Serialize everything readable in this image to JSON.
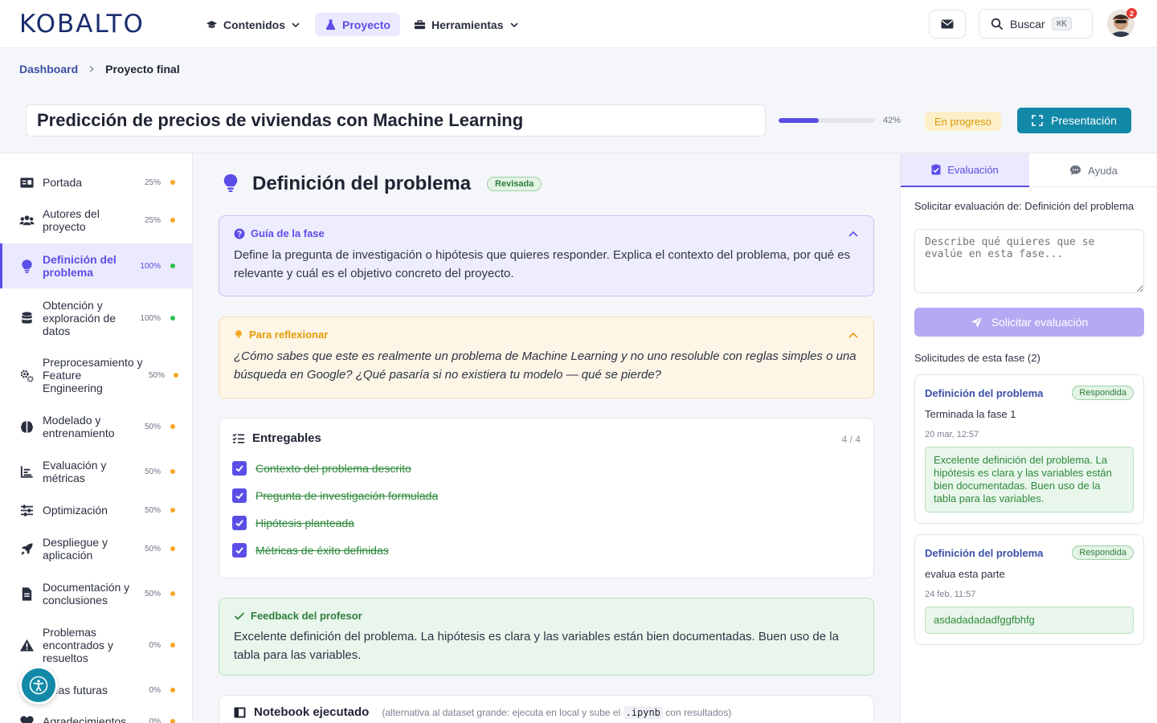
{
  "app": {
    "logo": "KOBALTO"
  },
  "nav": {
    "items": [
      {
        "label": "Contenidos",
        "icon": "graduation-cap-icon"
      },
      {
        "label": "Proyecto",
        "icon": "flask-icon"
      },
      {
        "label": "Herramientas",
        "icon": "toolbox-icon"
      }
    ],
    "search_label": "Buscar",
    "search_shortcut": "⌘K",
    "notification_count": "2"
  },
  "breadcrumb": {
    "root": "Dashboard",
    "current": "Proyecto final"
  },
  "project": {
    "title": "Predicción de precios de viviendas con Machine Learning",
    "progress": 42,
    "progress_label": "42%",
    "status": "En progreso",
    "present_label": "Presentación"
  },
  "sidebar": {
    "items": [
      {
        "label": "Portada",
        "pct": "25%",
        "status": "orange",
        "icon": "id-card-icon"
      },
      {
        "label": "Autores del proyecto",
        "pct": "25%",
        "status": "orange",
        "icon": "users-icon"
      },
      {
        "label": "Definición del problema",
        "pct": "100%",
        "status": "green",
        "icon": "lightbulb-icon",
        "active": true
      },
      {
        "label": "Obtención y exploración de datos",
        "pct": "100%",
        "status": "green",
        "icon": "database-icon"
      },
      {
        "label": "Preprocesamiento y Feature Engineering",
        "pct": "50%",
        "status": "orange",
        "icon": "gears-icon"
      },
      {
        "label": "Modelado y entrenamiento",
        "pct": "50%",
        "status": "orange",
        "icon": "brain-icon"
      },
      {
        "label": "Evaluación y métricas",
        "pct": "50%",
        "status": "orange",
        "icon": "chart-icon"
      },
      {
        "label": "Optimización",
        "pct": "50%",
        "status": "orange",
        "icon": "sliders-icon"
      },
      {
        "label": "Despliegue y aplicación",
        "pct": "50%",
        "status": "orange",
        "icon": "rocket-icon"
      },
      {
        "label": "Documentación y conclusiones",
        "pct": "50%",
        "status": "orange",
        "icon": "file-icon"
      },
      {
        "label": "Problemas encontrados y resueltos",
        "pct": "0%",
        "status": "orange",
        "icon": "warning-icon"
      },
      {
        "label": "Ideas futuras",
        "pct": "0%",
        "status": "orange",
        "icon": "idea-icon"
      },
      {
        "label": "Agradecimientos",
        "pct": "0%",
        "status": "orange",
        "icon": "heart-icon"
      }
    ]
  },
  "phase": {
    "title": "Definición del problema",
    "badge": "Revisada",
    "guide": {
      "title": "Guía de la fase",
      "text": "Define la pregunta de investigación o hipótesis que quieres responder. Explica el contexto del problema, por qué es relevante y cuál es el objetivo concreto del proyecto."
    },
    "reflect": {
      "title": "Para reflexionar",
      "text": "¿Cómo sabes que este es realmente un problema de Machine Learning y no uno resoluble con reglas simples o una búsqueda en Google? ¿Qué pasaría si no existiera tu modelo — qué se pierde?"
    },
    "deliverables": {
      "title": "Entregables",
      "count": "4 / 4",
      "items": [
        "Contexto del problema descrito",
        "Pregunta de investigación formulada",
        "Hipótesis planteada",
        "Métricas de éxito definidas"
      ]
    },
    "feedback": {
      "title": "Feedback del profesor",
      "text": "Excelente definición del problema. La hipótesis es clara y las variables están bien documentadas. Buen uso de la tabla para las variables."
    },
    "notebook": {
      "title": "Notebook ejecutado",
      "hint_before": "(alternativa al dataset grande: ejecuta en local y sube el",
      "hint_code": ".ipynb",
      "hint_after": "con resultados)"
    }
  },
  "right_panel": {
    "tabs": [
      "Evaluación",
      "Ayuda"
    ],
    "eval_label": "Solicitar evaluación de: Definición del problema",
    "eval_placeholder": "Describe qué quieres que se evalúe en esta fase...",
    "eval_button": "Solicitar evaluación",
    "requests_title": "Solicitudes de esta fase (2)",
    "requests": [
      {
        "phase": "Definición del problema",
        "badge": "Respondida",
        "text": "Terminada la fase 1",
        "date": "20 mar, 12:57",
        "response": "Excelente definición del problema. La hipótesis es clara y las variables están bien documentadas. Buen uso de la tabla para las variables."
      },
      {
        "phase": "Definición del problema",
        "badge": "Respondida",
        "text": "evalua esta parte",
        "date": "24 feb, 11:57",
        "response": "asdadadadadfggfbhfg"
      }
    ]
  },
  "colors": {
    "accent": "#5b4ee6",
    "teal": "#1389a8",
    "status_green": "#2fbf4f",
    "status_orange": "#f5a623"
  }
}
